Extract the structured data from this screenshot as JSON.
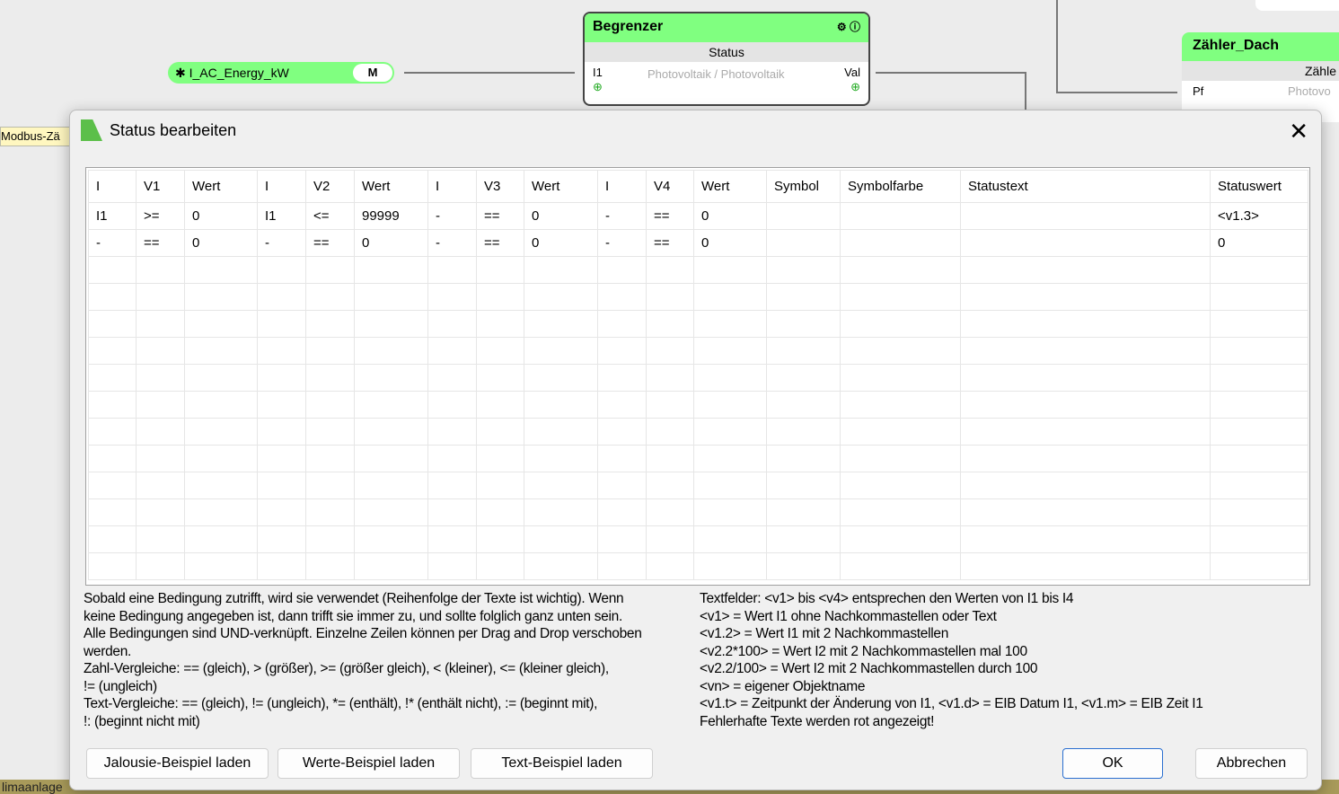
{
  "canvas": {
    "pill": {
      "label": "I_AC_Energy_kW",
      "mode": "M"
    },
    "begrenzer": {
      "title": "Begrenzer",
      "subtitle": "Status",
      "input": "I1",
      "desc": "Photovoltaik / Photovoltaik",
      "output": "Val"
    },
    "zaehler": {
      "title": "Zähler_Dach",
      "subtitle": "Zähle",
      "input": "Pf",
      "desc": "Photovo"
    },
    "modbus_label": "Modbus-Zä",
    "bottom_label": "limaanlage"
  },
  "dialog": {
    "title": "Status bearbeiten",
    "headers": [
      "I",
      "V1",
      "Wert",
      "I",
      "V2",
      "Wert",
      "I",
      "V3",
      "Wert",
      "I",
      "V4",
      "Wert",
      "Symbol",
      "Symbolfarbe",
      "Statustext",
      "Statuswert"
    ],
    "rows": [
      [
        "I1",
        ">=",
        "0",
        "I1",
        "<=",
        "99999",
        "-",
        "==",
        "0",
        "-",
        "==",
        "0",
        "",
        "",
        "",
        "<v1.3>"
      ],
      [
        "-",
        "==",
        "0",
        "-",
        "==",
        "0",
        "-",
        "==",
        "0",
        "-",
        "==",
        "0",
        "",
        "",
        "",
        "0"
      ]
    ],
    "help_left": [
      "Sobald eine Bedingung zutrifft, wird sie verwendet (Reihenfolge der Texte ist wichtig). Wenn",
      "keine Bedingung angegeben ist, dann trifft sie immer zu, und sollte folglich ganz unten sein.",
      "Alle Bedingungen sind UND-verknüpft. Einzelne Zeilen können per Drag and Drop verschoben",
      "werden.",
      "Zahl-Vergleiche: == (gleich), > (größer), >= (größer gleich), < (kleiner), <= (kleiner gleich),",
      "!= (ungleich)",
      "Text-Vergleiche: == (gleich), != (ungleich), *= (enthält), !* (enthält nicht), := (beginnt mit),",
      "!: (beginnt nicht mit)"
    ],
    "help_right": [
      "Textfelder: <v1> bis <v4> entsprechen den Werten von I1 bis I4",
      "<v1> = Wert I1 ohne Nachkommastellen oder Text",
      "<v1.2> = Wert I1 mit 2 Nachkommastellen",
      "<v2.2*100> = Wert I2 mit 2 Nachkommastellen mal 100",
      "<v2.2/100> = Wert I2 mit 2 Nachkommastellen durch 100",
      "<vn> = eigener Objektname",
      "<v1.t> = Zeitpunkt der Änderung von I1, <v1.d> = EIB Datum I1, <v1.m> = EIB Zeit I1",
      "Fehlerhafte Texte werden rot angezeigt!"
    ],
    "buttons": {
      "jalousie": "Jalousie-Beispiel laden",
      "werte": "Werte-Beispiel laden",
      "text": "Text-Beispiel laden",
      "ok": "OK",
      "cancel": "Abbrechen"
    }
  }
}
